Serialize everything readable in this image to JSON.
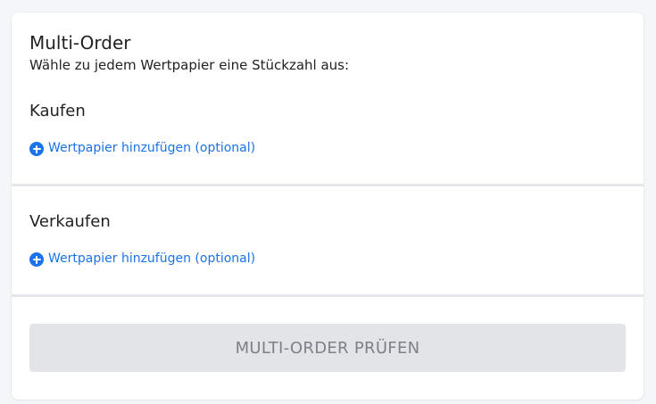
{
  "header": {
    "title": "Multi-Order",
    "subtitle": "Wähle zu jedem Wertpapier eine Stückzahl aus:"
  },
  "buy": {
    "heading": "Kaufen",
    "add_label": "Wertpapier hinzufügen (optional)"
  },
  "sell": {
    "heading": "Verkaufen",
    "add_label": "Wertpapier hinzufügen (optional)"
  },
  "footer": {
    "submit_label": "MULTI-ORDER PRÜFEN"
  },
  "icons": {
    "add": "plus-circle-icon"
  },
  "colors": {
    "accent": "#1a73e8",
    "button_disabled_bg": "#e2e4e8",
    "button_disabled_text": "#7c8089"
  }
}
